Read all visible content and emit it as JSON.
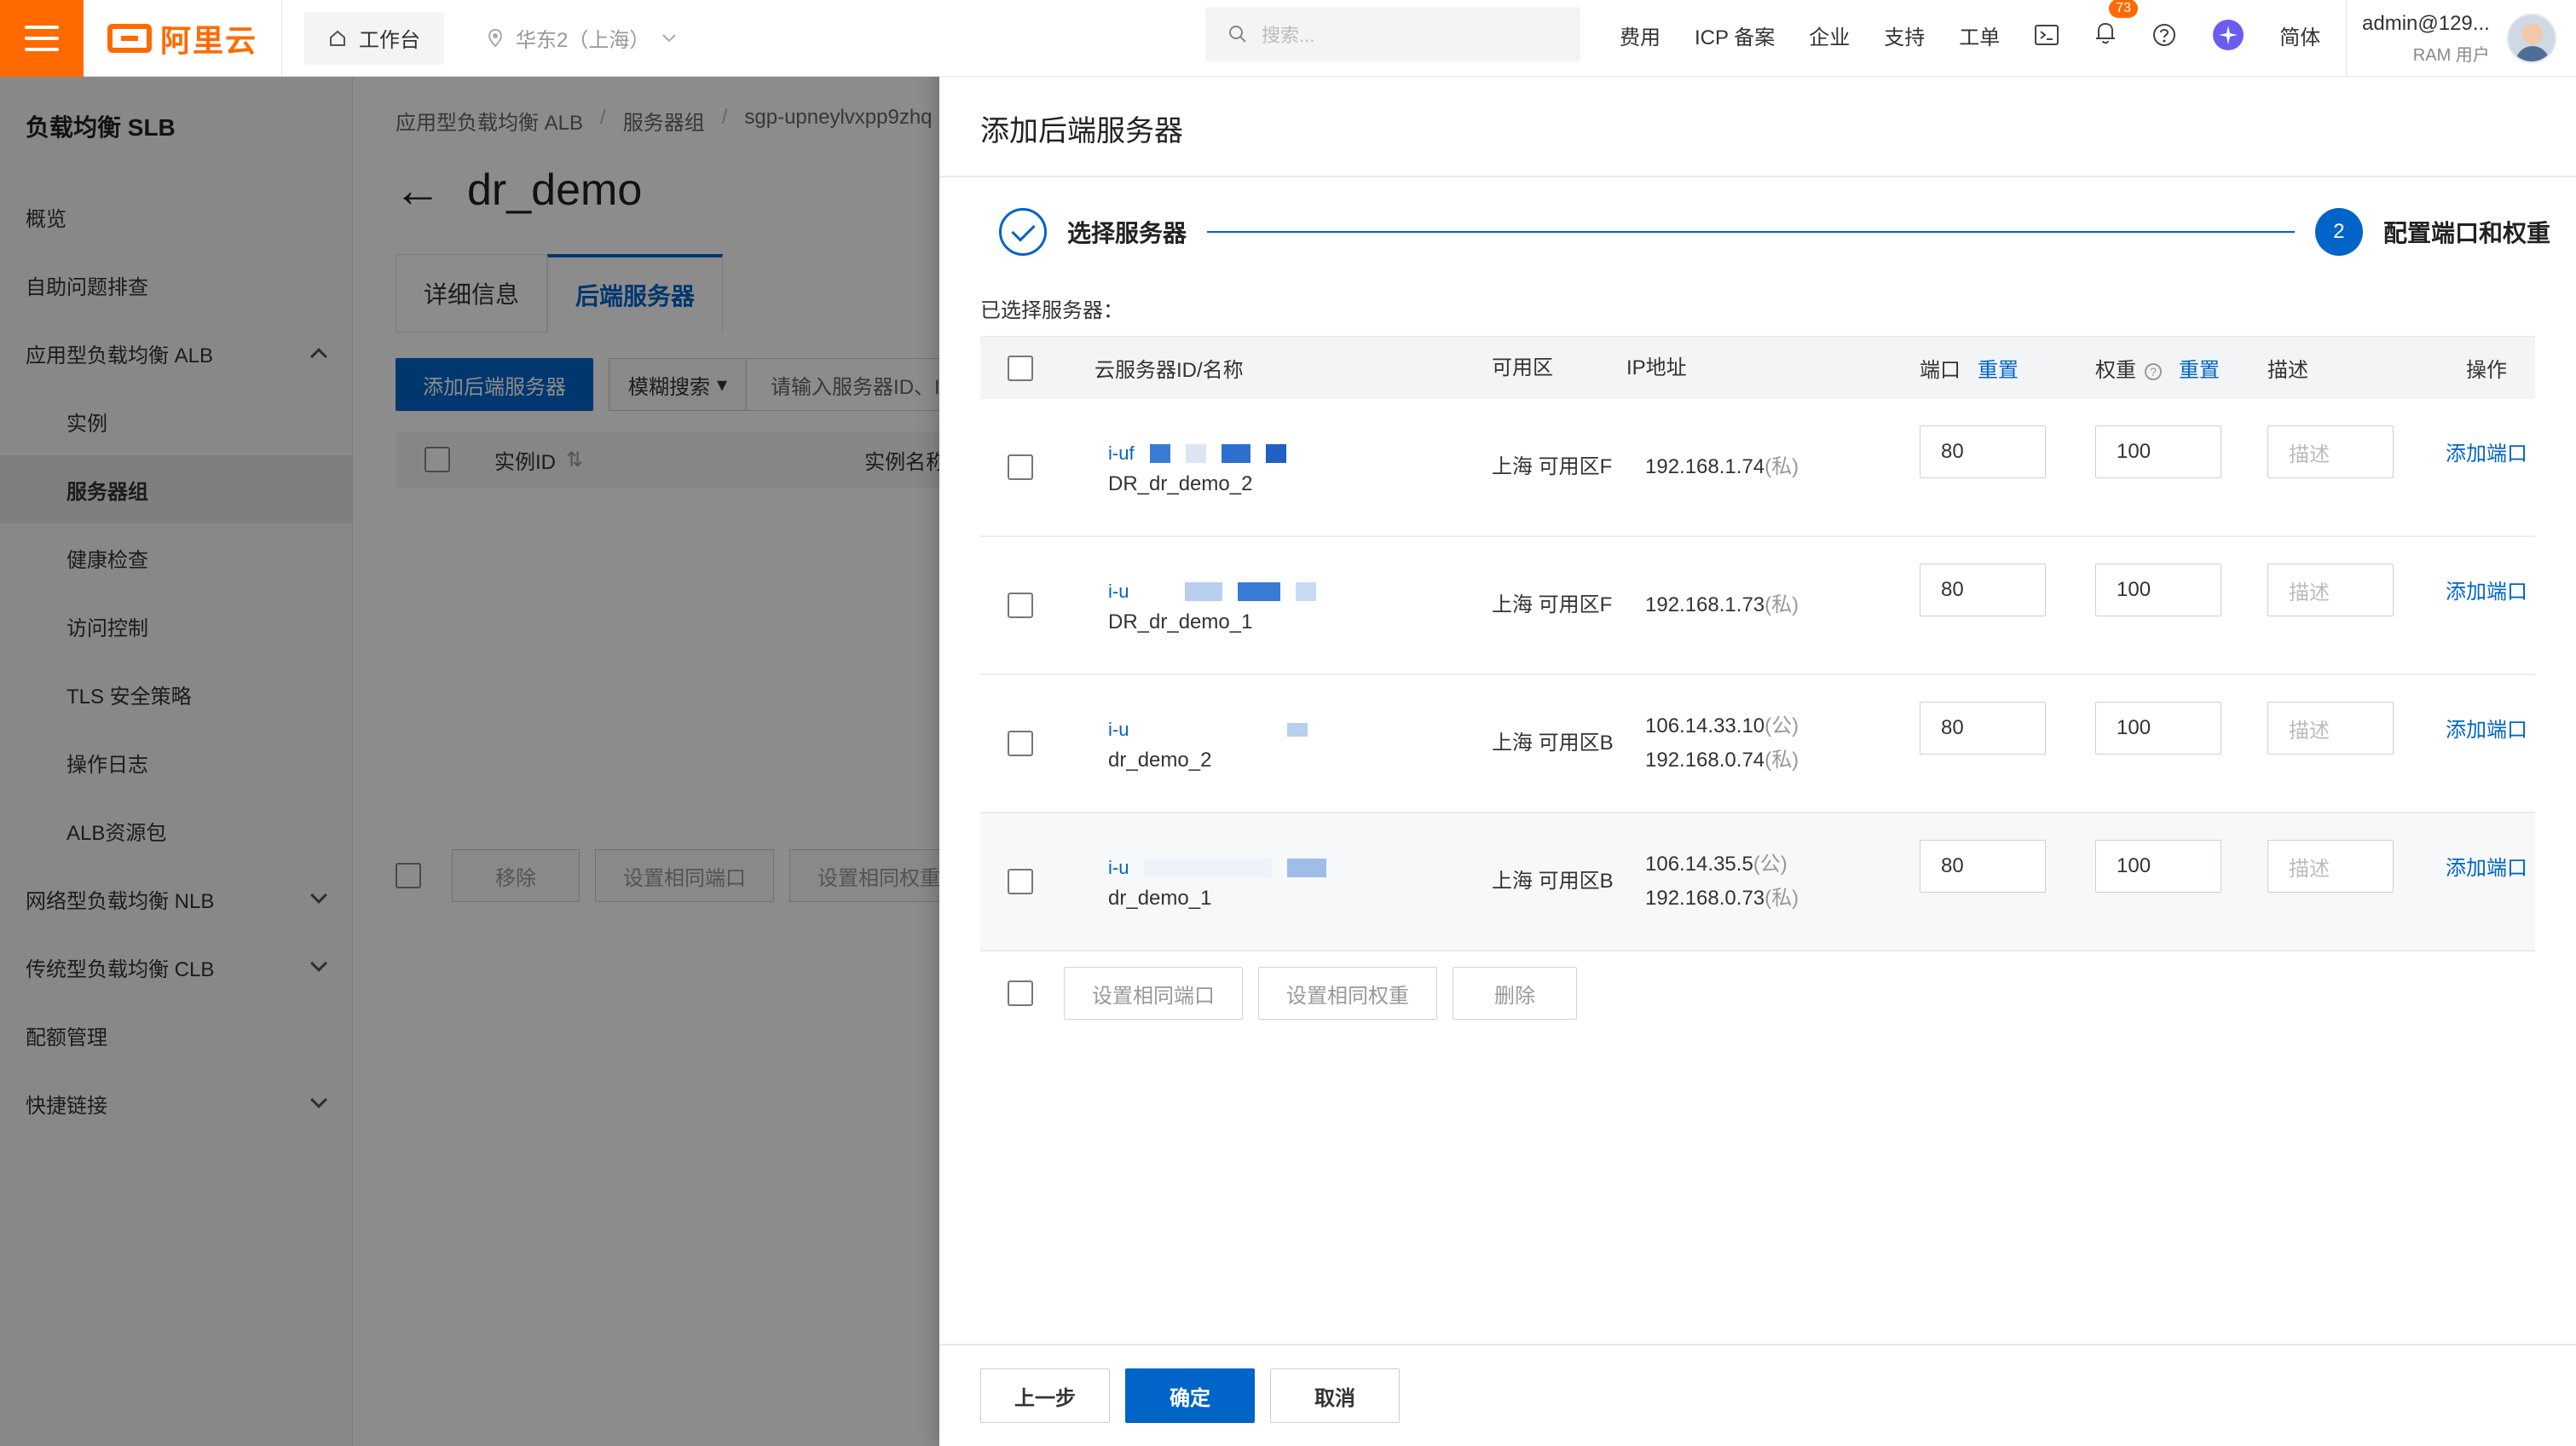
{
  "topbar": {
    "logo_text": "阿里云",
    "workbench": "工作台",
    "region": "华东2（上海）",
    "search_placeholder": "搜索...",
    "links": [
      "费用",
      "ICP 备案",
      "企业",
      "支持",
      "工单"
    ],
    "notification_count": "73",
    "language": "简体",
    "user_name": "admin@129...",
    "user_role": "RAM 用户",
    "accent_color": "#ff6a00"
  },
  "sidebar": {
    "title": "负载均衡 SLB",
    "items": [
      {
        "label": "概览"
      },
      {
        "label": "自助问题排查"
      },
      {
        "label": "应用型负载均衡 ALB"
      },
      {
        "label": "实例"
      },
      {
        "label": "服务器组"
      },
      {
        "label": "健康检查"
      },
      {
        "label": "访问控制"
      },
      {
        "label": "TLS 安全策略"
      },
      {
        "label": "操作日志"
      },
      {
        "label": "ALB资源包"
      },
      {
        "label": "网络型负载均衡 NLB"
      },
      {
        "label": "传统型负载均衡 CLB"
      },
      {
        "label": "配额管理"
      },
      {
        "label": "快捷链接"
      }
    ]
  },
  "main": {
    "breadcrumb": [
      "应用型负载均衡 ALB",
      "服务器组",
      "sgp-upneylvxpp9zhq"
    ],
    "title": "dr_demo",
    "tabs": [
      "详细信息",
      "后端服务器"
    ],
    "add_button": "添加后端服务器",
    "filter_select": "模糊搜索",
    "filter_placeholder": "请输入服务器ID、IP",
    "table_headers": [
      "实例ID",
      "实例名称"
    ],
    "bottom_buttons": [
      "移除",
      "设置相同端口",
      "设置相同权重"
    ]
  },
  "drawer": {
    "title": "添加后端服务器",
    "step1": "选择服务器",
    "step2_num": "2",
    "step2": "配置端口和权重",
    "selected_label": "已选择服务器：",
    "headers": {
      "id": "云服务器ID/名称",
      "zone": "可用区",
      "ip": "IP地址",
      "port": "端口",
      "weight": "权重",
      "reset": "重置",
      "help": "?",
      "desc": "描述",
      "op": "操作"
    },
    "rows": [
      {
        "id_prefix": "i-uf",
        "name": "DR_dr_demo_2",
        "zone": "上海 可用区F",
        "ip1": "192.168.1.74",
        "ip1_tag": "(私)",
        "ip2": "",
        "ip2_tag": "",
        "port": "80",
        "weight": "100",
        "desc_placeholder": "描述",
        "op": "添加端口"
      },
      {
        "id_prefix": "i-u",
        "name": "DR_dr_demo_1",
        "zone": "上海 可用区F",
        "ip1": "192.168.1.73",
        "ip1_tag": "(私)",
        "ip2": "",
        "ip2_tag": "",
        "port": "80",
        "weight": "100",
        "desc_placeholder": "描述",
        "op": "添加端口"
      },
      {
        "id_prefix": "i-u",
        "name": "dr_demo_2",
        "zone": "上海 可用区B",
        "ip1": "106.14.33.10",
        "ip1_tag": "(公)",
        "ip2": "192.168.0.74",
        "ip2_tag": "(私)",
        "port": "80",
        "weight": "100",
        "desc_placeholder": "描述",
        "op": "添加端口"
      },
      {
        "id_prefix": "i-u",
        "name": "dr_demo_1",
        "zone": "上海 可用区B",
        "ip1": "106.14.35.5",
        "ip1_tag": "(公)",
        "ip2": "192.168.0.73",
        "ip2_tag": "(私)",
        "port": "80",
        "weight": "100",
        "desc_placeholder": "描述",
        "op": "添加端口"
      }
    ],
    "batch_buttons": [
      "设置相同端口",
      "设置相同权重",
      "删除"
    ],
    "footer": {
      "prev": "上一步",
      "confirm": "确定",
      "cancel": "取消"
    },
    "primary_color": "#0064c8"
  }
}
